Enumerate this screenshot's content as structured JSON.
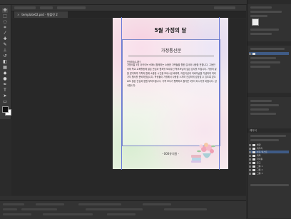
{
  "window": {
    "doc_tab": "template02.psd - 템플릿 2",
    "close_glyph": "×"
  },
  "document": {
    "title": "5월 가정의 달",
    "letter_title": "가정통신문",
    "greeting": "안녕하십니까?",
    "body": "가정의달 5월 아카이브 속에서 함께하는 소중한 가족들을 향한 감사와 사랑을 전합니다. 그동안 저희 학교 교육활동에 많은 관심과 협조를 보내주신 학부모님께 깊은 감사를 드립니다. 가정의 달을 맞이하여 가족과 함께 소중한 시간을 보내시길 바라며, 어린이날과 어버이날을 기념하여 여러 가지 행사를 준비하였습니다. 학생들이 가정에서 사랑을 느끼며 건강하게 성장할 수 있도록 앞으로도 많은 관심과 응원 부탁드립니다. 가족 모두가 행복하고 즐거운 5월이 되시기를 바랍니다. 감사합니다.",
    "footer": "- 000유치원 -"
  },
  "panels": {
    "layers_tab": "레이어",
    "selected_layer": "본문 텍스트",
    "layers": [
      "배경",
      "테두리",
      "꽃 장식",
      "제목",
      "본문 텍스트",
      "타이틀",
      "로고",
      "그룹 1",
      "그룹 2",
      "그룹 3"
    ]
  },
  "icons": {
    "tools": [
      "move",
      "marquee",
      "lasso",
      "crop",
      "eyedropper",
      "heal",
      "brush",
      "stamp",
      "history",
      "eraser",
      "gradient",
      "blur",
      "dodge",
      "pen",
      "type",
      "path",
      "shape",
      "hand",
      "zoom"
    ]
  },
  "colors": {
    "foreground": "#111111",
    "background": "#ffffff",
    "guide": "#6a7bd8"
  }
}
